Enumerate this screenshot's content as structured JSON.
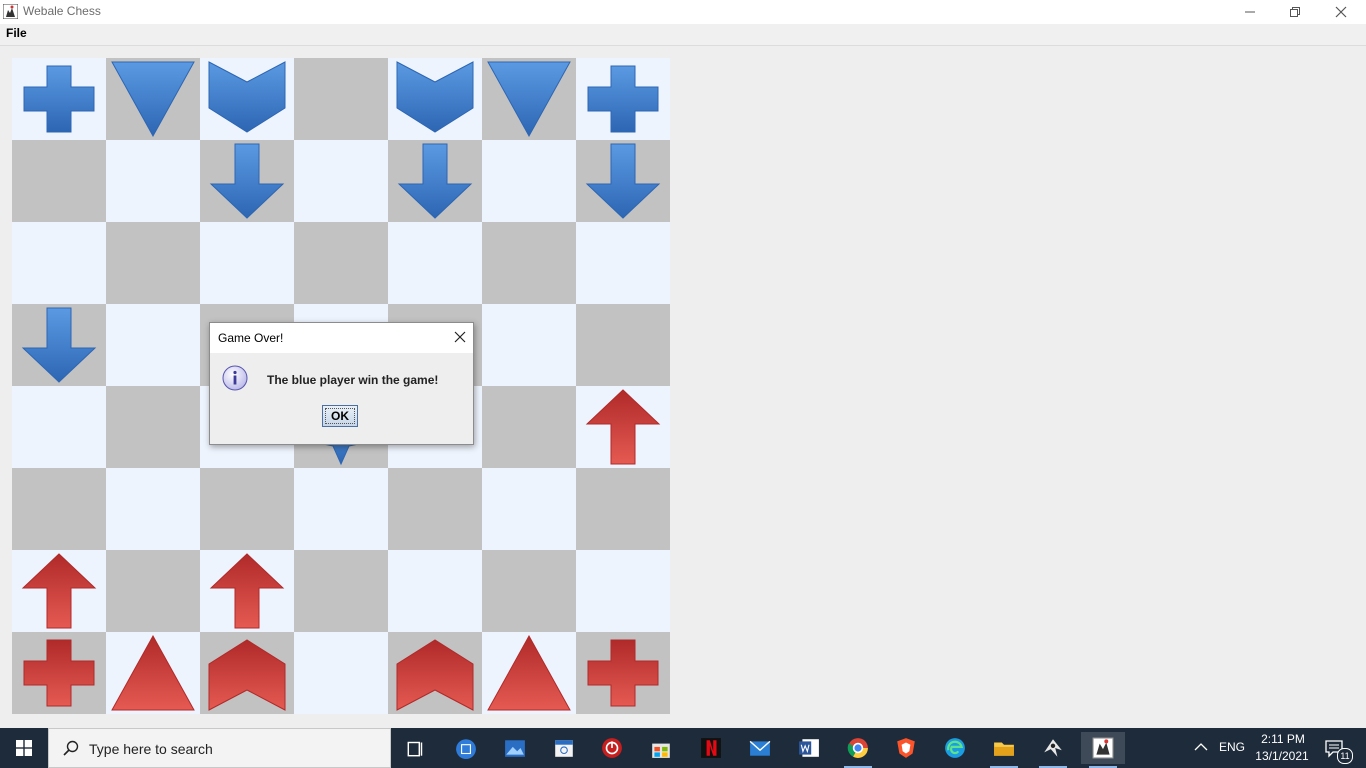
{
  "window": {
    "title": "Webale Chess",
    "icon": "chess-app-icon",
    "controls": [
      "minimize-icon",
      "restore-icon",
      "close-icon"
    ]
  },
  "menu": {
    "file_label": "File"
  },
  "board": {
    "cols": 7,
    "rows": 8,
    "colors": {
      "light": "#eef4fd",
      "dark": "#c2c2c2",
      "blue": "#3a7fd0",
      "red": "#d33c3a"
    },
    "pieces": [
      {
        "row": 0,
        "col": 0,
        "type": "plus",
        "color": "blue"
      },
      {
        "row": 0,
        "col": 1,
        "type": "triangle",
        "color": "blue"
      },
      {
        "row": 0,
        "col": 2,
        "type": "chevron",
        "color": "blue"
      },
      {
        "row": 0,
        "col": 4,
        "type": "chevron",
        "color": "blue"
      },
      {
        "row": 0,
        "col": 5,
        "type": "triangle",
        "color": "blue"
      },
      {
        "row": 0,
        "col": 6,
        "type": "plus",
        "color": "blue"
      },
      {
        "row": 1,
        "col": 2,
        "type": "arrow",
        "color": "blue"
      },
      {
        "row": 1,
        "col": 4,
        "type": "arrow",
        "color": "blue"
      },
      {
        "row": 1,
        "col": 6,
        "type": "arrow",
        "color": "blue"
      },
      {
        "row": 3,
        "col": 0,
        "type": "arrow",
        "color": "blue"
      },
      {
        "row": 4,
        "col": 3,
        "type": "star",
        "color": "blue"
      },
      {
        "row": 4,
        "col": 4,
        "type": "block",
        "color": "red"
      },
      {
        "row": 4,
        "col": 6,
        "type": "arrow",
        "color": "red"
      },
      {
        "row": 6,
        "col": 0,
        "type": "arrow",
        "color": "red"
      },
      {
        "row": 6,
        "col": 2,
        "type": "arrow",
        "color": "red"
      },
      {
        "row": 7,
        "col": 0,
        "type": "plus",
        "color": "red"
      },
      {
        "row": 7,
        "col": 1,
        "type": "triangle",
        "color": "red"
      },
      {
        "row": 7,
        "col": 2,
        "type": "chevron",
        "color": "red"
      },
      {
        "row": 7,
        "col": 4,
        "type": "chevron",
        "color": "red"
      },
      {
        "row": 7,
        "col": 5,
        "type": "triangle",
        "color": "red"
      },
      {
        "row": 7,
        "col": 6,
        "type": "plus",
        "color": "red"
      }
    ]
  },
  "dialog": {
    "title": "Game Over!",
    "message": "The blue player win the game!",
    "ok_label": "OK",
    "icon": "info-icon"
  },
  "taskbar": {
    "search_placeholder": "Type here to search",
    "apps": [
      "task-view-icon",
      "cortana-icon",
      "photos-icon",
      "calendar-icon",
      "power-app-icon",
      "store-icon",
      "netflix-icon",
      "mail-icon",
      "word-icon",
      "chrome-icon",
      "brave-icon",
      "edge-icon",
      "file-explorer-icon",
      "inkscape-icon",
      "webale-chess-icon"
    ],
    "language": "ENG",
    "time": "2:11 PM",
    "date": "13/1/2021",
    "notification_count": "11"
  }
}
